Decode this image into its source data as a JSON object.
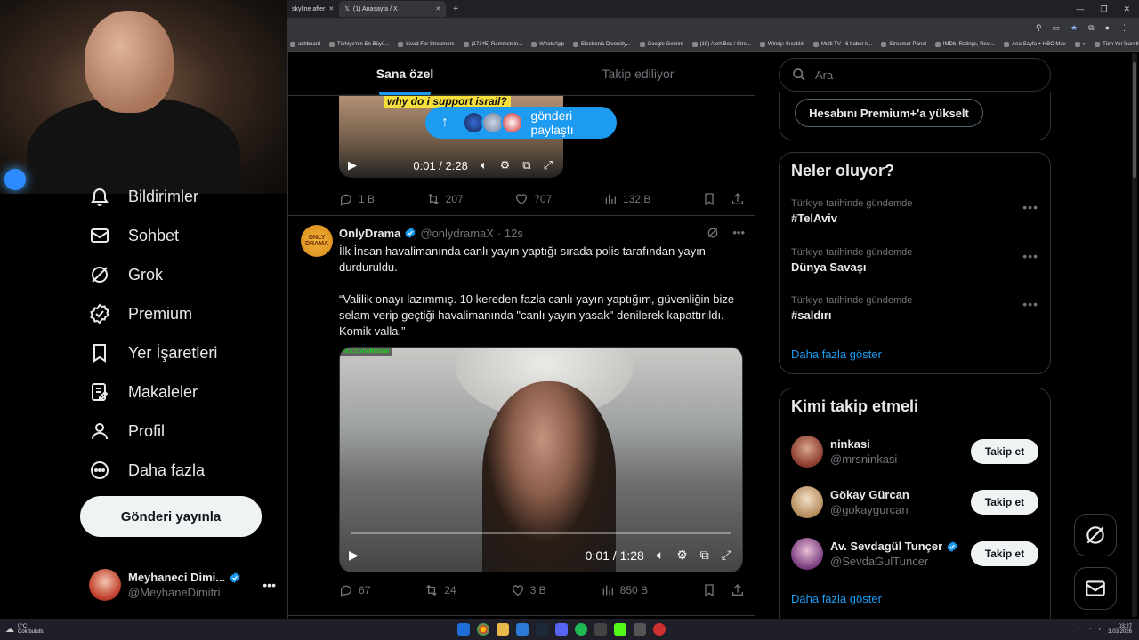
{
  "browser": {
    "tabs": [
      {
        "label": "skyline after",
        "active": false
      },
      {
        "label": "(1) Anasayfa / X",
        "active": true
      }
    ],
    "bookmarks": [
      "ashboard",
      "Türkiye'nin En Büyü...",
      "Livad For Streamers",
      "(17145) Rammstein...",
      "WhatsApp",
      "Electronic Diversity...",
      "Google Gemini",
      "(19) Alert Box / Stre...",
      "Windy: Sıcaklık",
      "Multi TV - 6 haber k...",
      "Streamer Panel",
      "IMDb: Ratings, Revi...",
      "Ana Sayfa + HBO Max",
      "»",
      "Tüm Yer İşaretleri"
    ]
  },
  "nav": {
    "items": [
      {
        "label": "Bildirimler",
        "icon": "bell-icon"
      },
      {
        "label": "Sohbet",
        "icon": "mail-icon"
      },
      {
        "label": "Grok",
        "icon": "grok-icon"
      },
      {
        "label": "Premium",
        "icon": "verified-icon"
      },
      {
        "label": "Yer İşaretleri",
        "icon": "bookmark-icon"
      },
      {
        "label": "Makaleler",
        "icon": "article-icon"
      },
      {
        "label": "Profil",
        "icon": "person-icon"
      },
      {
        "label": "Daha fazla",
        "icon": "more-icon"
      }
    ],
    "post_button": "Gönderi yayınla",
    "account": {
      "name": "Meyhaneci Dimi...",
      "handle": "@MeyhaneDimitri"
    }
  },
  "feed": {
    "tabs": [
      {
        "label": "Sana özel",
        "active": true
      },
      {
        "label": "Takip ediliyor",
        "active": false
      }
    ],
    "share_pill": "gönderi paylaştı",
    "post1": {
      "video_caption": "why do i support israil?",
      "video_time": "0:01 / 2:28",
      "stats": {
        "replies": "1 B",
        "reposts": "207",
        "likes": "707",
        "views": "132 B"
      }
    },
    "post2": {
      "name": "OnlyDrama",
      "handle": "@onlydramaX",
      "time": "· 12s",
      "avatar_text": "ONLY DRAMA",
      "text": "İlk İnsan havalimanında canlı yayın yaptığı sırada polis tarafından yayın durduruldu.\n\n“Valilik onayı lazımmış. 10 kereden fazla canlı yayın yaptığım, güvenliğin bize selam verip geçtiği havalimanında \"canlı yayın yasak\" denilerek kapattırıldı. Komik valla.”",
      "video_tag": "kick.com/ilkinsan",
      "video_time": "0:01 / 1:28",
      "stats": {
        "replies": "67",
        "reposts": "24",
        "likes": "3 B",
        "views": "850 B"
      }
    }
  },
  "sidebar": {
    "search_placeholder": "Ara",
    "premium_button": "Hesabını Premium+'a yükselt",
    "trends_title": "Neler oluyor?",
    "trends": [
      {
        "context": "Türkiye tarihinde gündemde",
        "name": "#TelAviv"
      },
      {
        "context": "Türkiye tarihinde gündemde",
        "name": "Dünya Savaşı"
      },
      {
        "context": "Türkiye tarihinde gündemde",
        "name": "#saldırı"
      }
    ],
    "trends_more": "Daha fazla göster",
    "who_title": "Kimi takip etmeli",
    "who": [
      {
        "name": "ninkasi",
        "handle": "@mrsninkasi",
        "verified": false,
        "button": "Takip et"
      },
      {
        "name": "Gökay Gürcan",
        "handle": "@gokaygurcan",
        "verified": false,
        "button": "Takip et"
      },
      {
        "name": "Av. Sevdagül Tunçer",
        "handle": "@SevdaGulTuncer",
        "verified": true,
        "button": "Takip et"
      }
    ],
    "who_more": "Daha fazla göster"
  },
  "taskbar": {
    "weather_temp": "0°C",
    "weather_text": "Çok bulutlu",
    "clock_time": "03:27",
    "clock_date": "3.03.2026"
  },
  "colors": {
    "accent": "#1d9bf0",
    "background": "#000000",
    "text": "#e7e9ea",
    "muted": "#71767b"
  }
}
